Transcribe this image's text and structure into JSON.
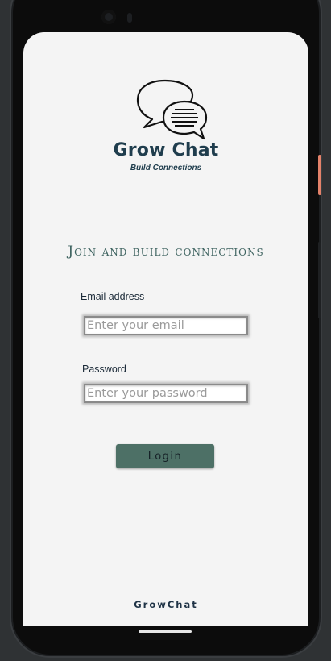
{
  "brand": {
    "title": "Grow Chat",
    "tagline": "Build Connections",
    "logo_icon": "chat-bubbles-icon",
    "color": "#1f3d4d"
  },
  "heading": "Join and build connections",
  "form": {
    "email_label": "Email address",
    "email_placeholder": "Enter your email",
    "email_value": "",
    "password_label": "Password",
    "password_placeholder": "Enter your password",
    "password_value": "",
    "login_label": "Login",
    "button_color": "#4d7066"
  },
  "footer": "GrowChat",
  "device": {
    "screen_bg": "#f4f4f4",
    "frame_bg": "#2f3234",
    "accent_button_color": "#e4826a"
  }
}
